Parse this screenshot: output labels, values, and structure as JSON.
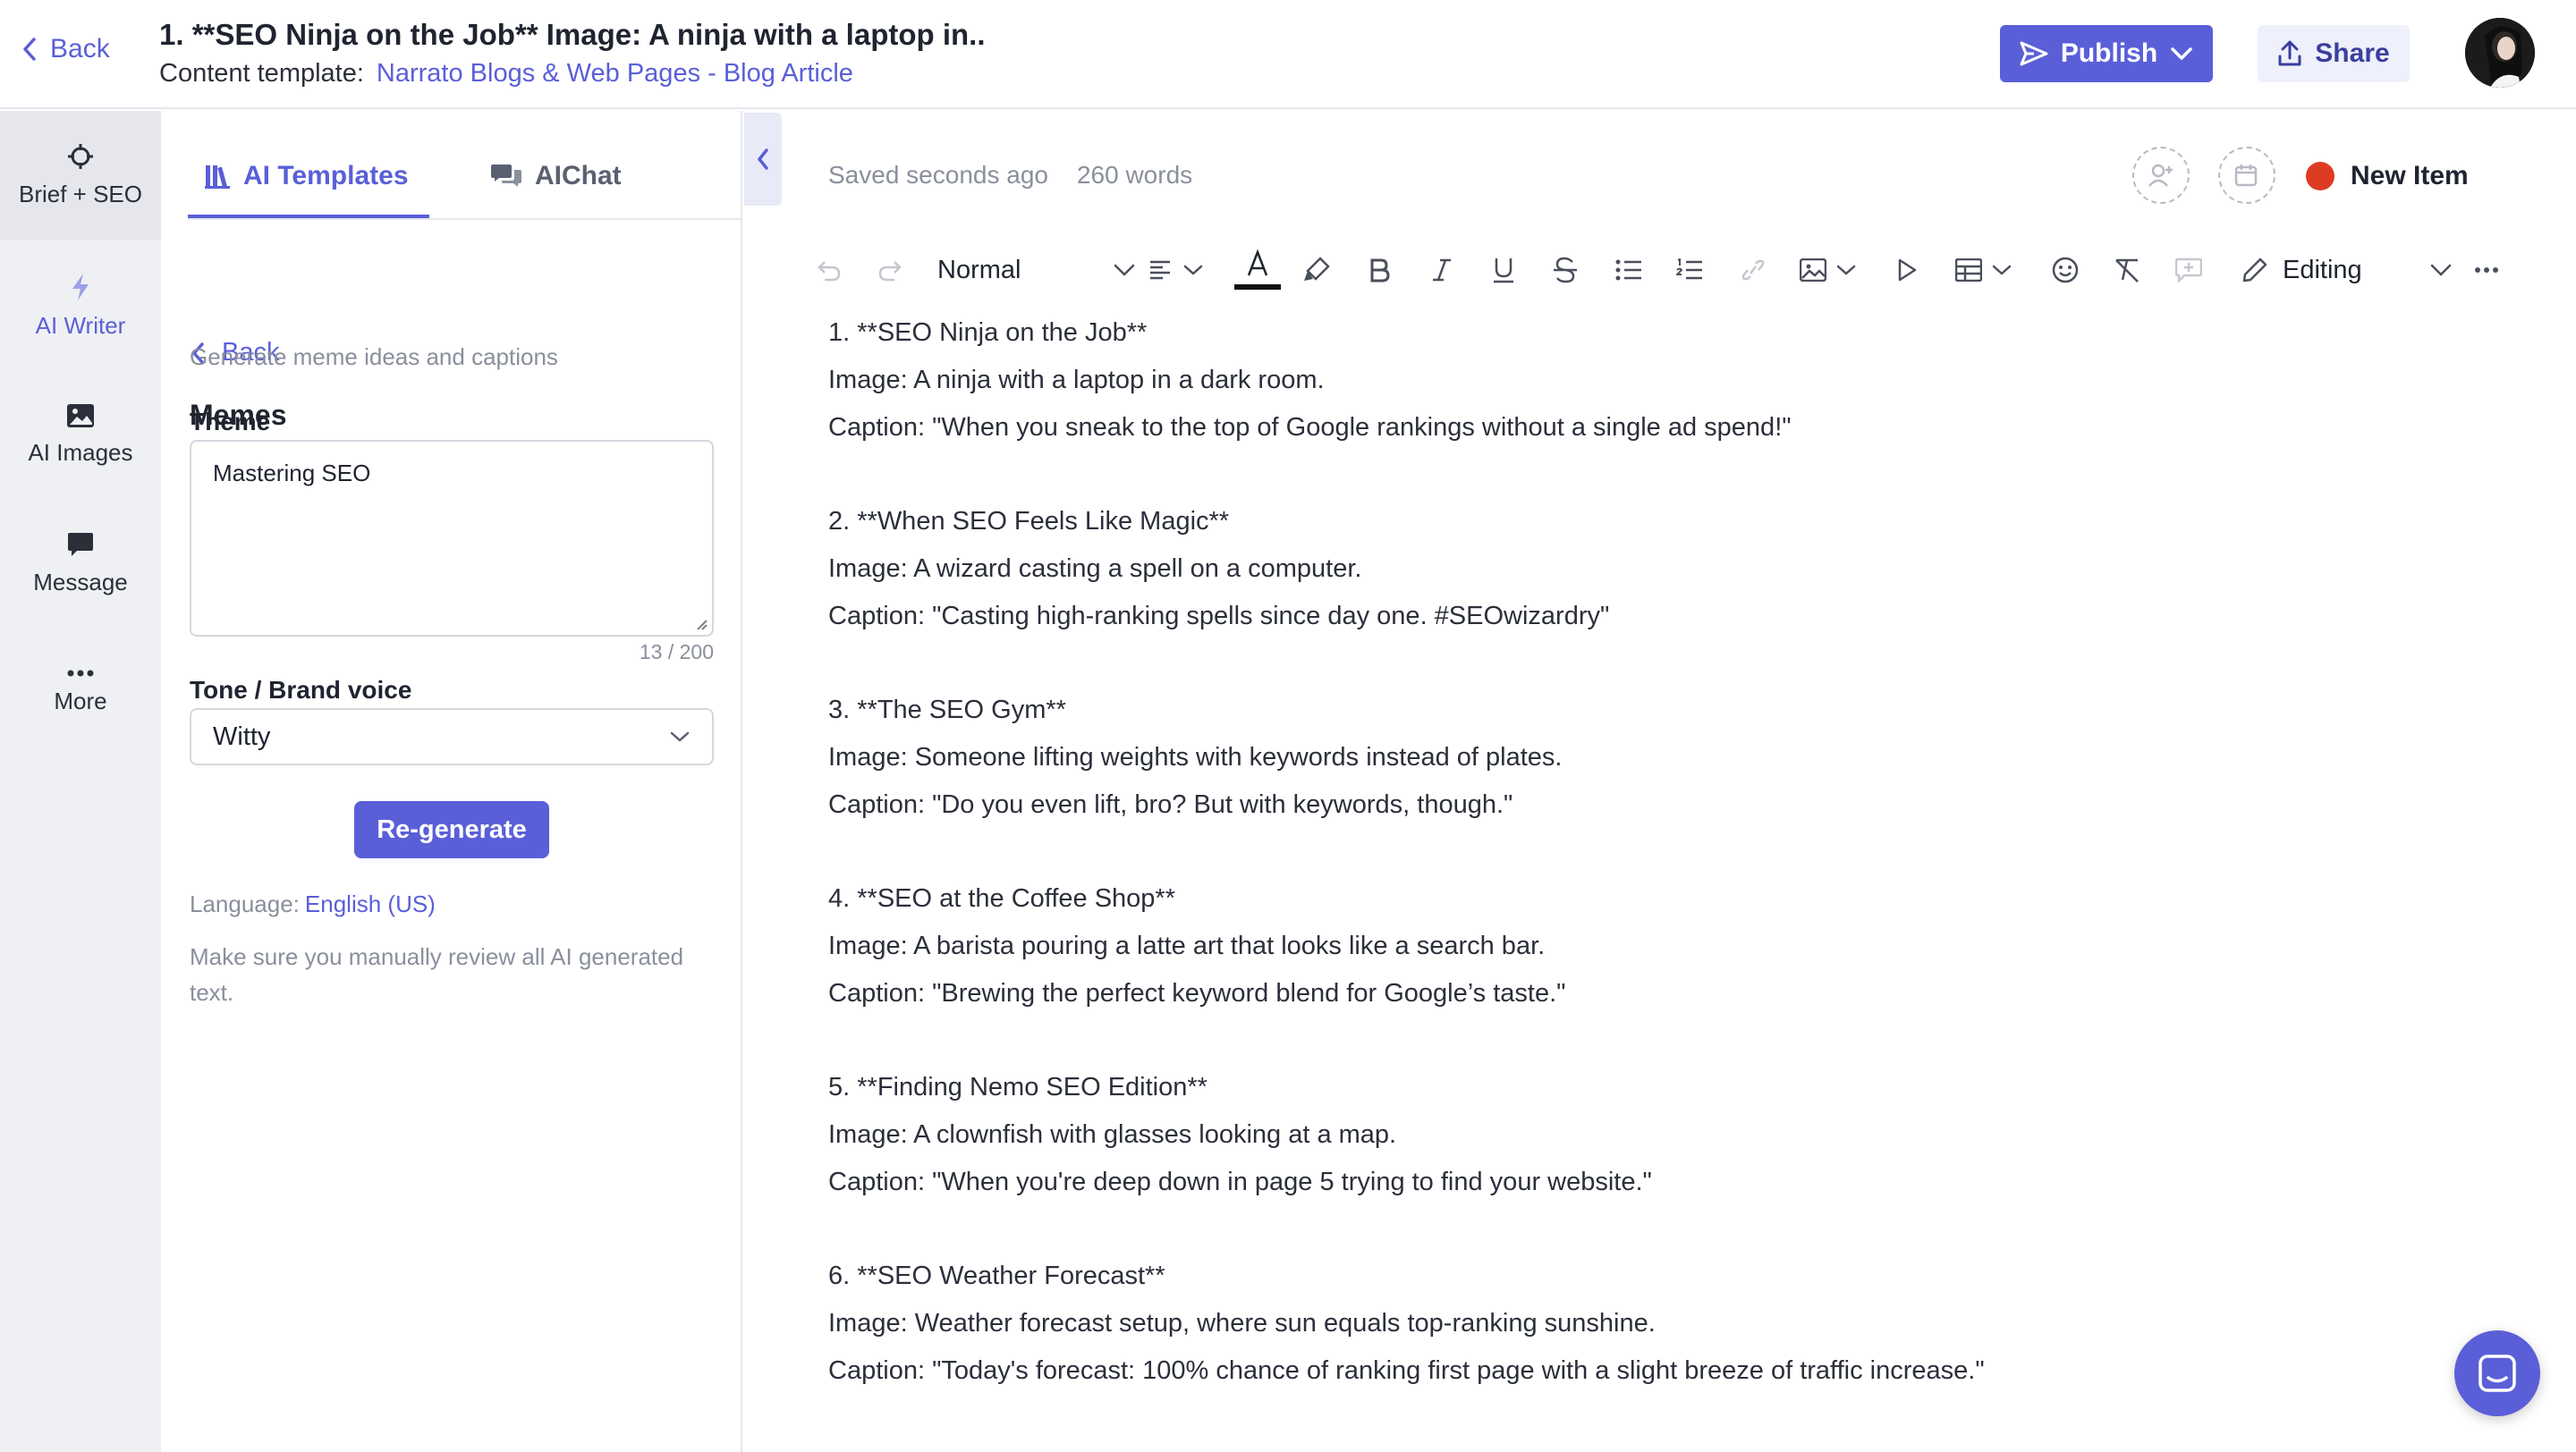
{
  "header": {
    "back_label": "Back",
    "doc_title": "1. **SEO Ninja on the Job**  Image: A ninja with a laptop in..",
    "template_label": "Content template:",
    "template_link": "Narrato Blogs & Web Pages - Blog Article",
    "publish_label": "Publish",
    "share_label": "Share"
  },
  "rail": {
    "items": [
      {
        "label": "Brief + SEO",
        "icon": "crosshair-icon"
      },
      {
        "label": "AI Writer",
        "icon": "bolt-icon"
      },
      {
        "label": "AI Images",
        "icon": "image-icon"
      },
      {
        "label": "Message",
        "icon": "message-icon"
      },
      {
        "label": "More",
        "icon": "more-icon"
      }
    ]
  },
  "panel": {
    "tabs": [
      {
        "label": "AI Templates",
        "icon": "library-icon"
      },
      {
        "label": "AIChat",
        "icon": "chat-icon"
      }
    ],
    "back_label": "Back",
    "heading": "Memes",
    "subheading": "Generate meme ideas and captions",
    "theme_label": "Theme",
    "theme_value": "Mastering SEO",
    "theme_counter": "13 / 200",
    "tone_label": "Tone / Brand voice",
    "tone_value": "Witty",
    "regenerate_label": "Re-generate",
    "language_label": "Language:",
    "language_value": "English (US)",
    "note": "Make sure you manually review all AI generated text."
  },
  "editor": {
    "saved_status": "Saved seconds ago",
    "word_count": "260 words",
    "state_label": "New Item",
    "state_color": "#dd3b22",
    "toolbar": {
      "style_value": "Normal",
      "mode_value": "Editing"
    },
    "lines": [
      {
        "text": "1. **SEO Ninja on the Job**"
      },
      {
        "text": "Image: A ninja with a laptop in a dark room."
      },
      {
        "text": "Caption: \"When you sneak to the top of Google rankings without a single ad spend!\""
      },
      {
        "text": ""
      },
      {
        "text": "2. **When SEO Feels Like Magic**"
      },
      {
        "text": "Image: A wizard casting a spell on a computer."
      },
      {
        "text": "Caption: \"Casting high-ranking spells since day one. #SEOwizardry\""
      },
      {
        "text": ""
      },
      {
        "text": "3. **The SEO Gym**"
      },
      {
        "text": "Image: Someone lifting weights with keywords instead of plates."
      },
      {
        "text": "Caption: \"Do you even lift, bro? But with keywords, though.\""
      },
      {
        "text": ""
      },
      {
        "text": "4. **SEO at the Coffee Shop**"
      },
      {
        "text": "Image: A barista pouring a latte art that looks like a search bar."
      },
      {
        "text": "Caption: \"Brewing the perfect keyword blend for Google’s taste.\""
      },
      {
        "text": ""
      },
      {
        "text": "5. **Finding Nemo SEO Edition**"
      },
      {
        "text": "Image: A clownfish with glasses looking at a map."
      },
      {
        "text": "Caption: \"When you're deep down in page 5 trying to find your website.\""
      },
      {
        "text": ""
      },
      {
        "text": "6. **SEO Weather Forecast**"
      },
      {
        "text": "Image: Weather forecast setup, where sun equals top-ranking sunshine."
      },
      {
        "text": "Caption: \"Today's forecast: 100% chance of ranking first page with a slight breeze of traffic increase.\""
      }
    ]
  },
  "colors": {
    "accent": "#5a5fd8",
    "rail_bg": "#eff0f3",
    "status_dot": "#dd3b22"
  }
}
